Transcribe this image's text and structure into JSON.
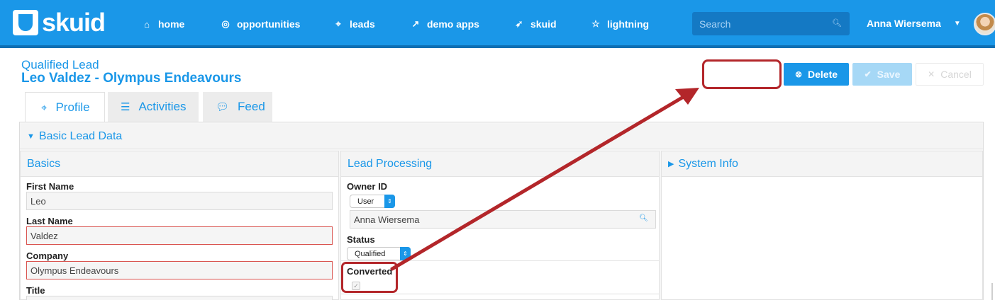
{
  "app": {
    "logo_text": "skuid",
    "nav": [
      {
        "label": "home",
        "icon": "home-icon"
      },
      {
        "label": "opportunities",
        "icon": "target-icon"
      },
      {
        "label": "leads",
        "icon": "crosshair-icon"
      },
      {
        "label": "demo apps",
        "icon": "external-link-icon"
      },
      {
        "label": "skuid",
        "icon": "rocket-icon"
      },
      {
        "label": "lightning",
        "icon": "star-icon"
      }
    ],
    "search_placeholder": "Search",
    "user_name": "Anna Wiersema",
    "accent_color": "#1a97e8"
  },
  "record": {
    "subtitle": "Qualified Lead",
    "title": "Leo Valdez - Olympus Endeavours"
  },
  "actions": {
    "delete_label": "Delete",
    "save_label": "Save",
    "cancel_label": "Cancel"
  },
  "tabs": [
    {
      "label": "Profile",
      "icon": "crosshair-icon",
      "active": true
    },
    {
      "label": "Activities",
      "icon": "list-icon",
      "active": false
    },
    {
      "label": "Feed",
      "icon": "comments-icon",
      "active": false
    }
  ],
  "section": {
    "title": "Basic Lead Data"
  },
  "basics": {
    "title": "Basics",
    "first_name_label": "First Name",
    "first_name": "Leo",
    "last_name_label": "Last Name",
    "last_name": "Valdez",
    "company_label": "Company",
    "company": "Olympus Endeavours",
    "title_label": "Title"
  },
  "lead_processing": {
    "title": "Lead Processing",
    "owner_label": "Owner ID",
    "owner_type": "User",
    "owner_name": "Anna Wiersema",
    "status_label": "Status",
    "status_value": "Qualified",
    "converted_label": "Converted",
    "converted_checked": true
  },
  "system_info": {
    "title": "System Info"
  },
  "annotation_color": "#b3262a"
}
